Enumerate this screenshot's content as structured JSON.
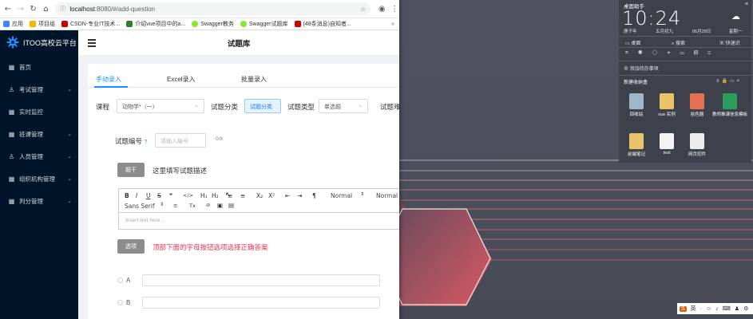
{
  "browser": {
    "url_host": "localhost",
    "url_path": ":8080/#/add-question",
    "bookmarks": [
      {
        "label": "应用",
        "color": "#4285f4"
      },
      {
        "label": "项目组",
        "color": "#f4b400"
      },
      {
        "label": "CSDN-专业IT技术...",
        "color": "#c00"
      },
      {
        "label": "介绍vue项目中的a...",
        "color": "#2e7d32"
      },
      {
        "label": "Swagger教务",
        "color": "#85ea2d"
      },
      {
        "label": "Swagger试题库",
        "color": "#85ea2d"
      },
      {
        "label": "(48条消息)自知者...",
        "color": "#c00"
      }
    ]
  },
  "sidebar": {
    "logo_text": "ITOO高校云平台",
    "items": [
      {
        "label": "首页",
        "icon": "grid-icon",
        "has_chevron": false
      },
      {
        "label": "考试管理",
        "icon": "user-icon",
        "has_chevron": true
      },
      {
        "label": "实时监控",
        "icon": "grid-icon",
        "has_chevron": false
      },
      {
        "label": "班课管理",
        "icon": "grid-icon",
        "has_chevron": true
      },
      {
        "label": "人员管理",
        "icon": "user-icon",
        "has_chevron": true
      },
      {
        "label": "组织机构管理",
        "icon": "grid-icon",
        "has_chevron": true
      },
      {
        "label": "判分管理",
        "icon": "grid-icon",
        "has_chevron": true
      }
    ]
  },
  "header": {
    "title": "试题库"
  },
  "tabs": [
    "手动录入",
    "Excel录入",
    "批量录入"
  ],
  "form": {
    "course_label": "课程",
    "course_value": "动物学*（一）",
    "category_label": "试题分类",
    "category_value": "试题分类",
    "type_label": "试题类型",
    "type_value": "单选题",
    "difficulty_label": "试题难度",
    "code_label": "试题编号",
    "code_placeholder": "请输入编号",
    "code_counter": "0/8",
    "stem_button": "题干",
    "stem_hint": "这里填写试题描述",
    "editor_placeholder": "Insert text here ...",
    "editor_tools": {
      "bold": "B",
      "italic": "I",
      "underline": "U",
      "strike": "S",
      "quote": "❞",
      "code": "</>",
      "h1": "H₁",
      "h2": "H₂",
      "ol": "≡",
      "ul": "≡",
      "sub": "X₂",
      "sup": "X²",
      "outdent": "⇤",
      "indent": "⇥",
      "rtl": "¶",
      "size": "Normal",
      "header": "Normal",
      "font": "Sans Serif",
      "clear": "Tx",
      "link": "🔗",
      "image": "▣",
      "video": "▤"
    },
    "options_button": "选项",
    "options_hint": "顶部下面的字母按钮选项选择正确答案",
    "options": [
      "A",
      "B"
    ]
  },
  "assistant": {
    "title": "桌面助手",
    "time": "10:24",
    "date_labels": [
      "庚子年",
      "五月初九",
      "06月29日",
      "星期一"
    ],
    "tabs": [
      "桌面",
      "搜索",
      "快速识"
    ],
    "todo_label": "添加待办事项",
    "folder_title": "新建收纳盒",
    "icons": [
      "回收站",
      "vue 实例",
      "拾色器",
      "教师推课信息模板",
      "前端笔记",
      "test",
      "网页控件"
    ]
  },
  "taskbar": {
    "ime": "英",
    "items": [
      "英",
      "·",
      "☺",
      "🎤",
      "⌨",
      "👕",
      "⚙"
    ]
  }
}
